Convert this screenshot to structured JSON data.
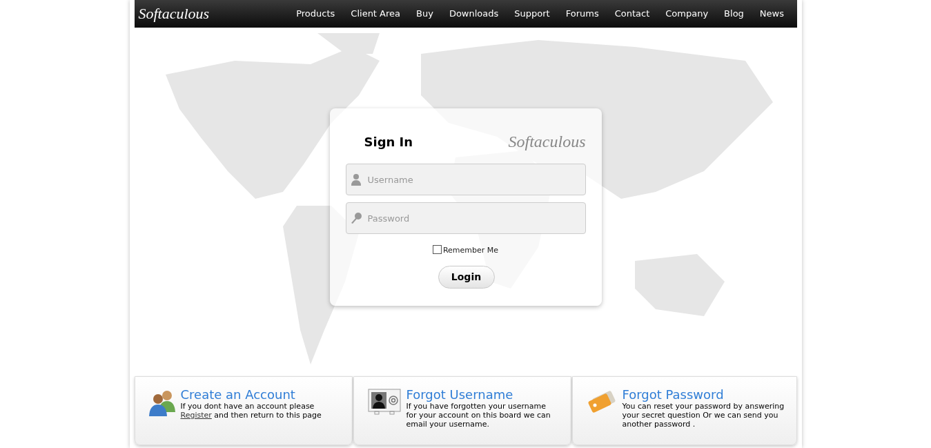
{
  "header": {
    "logo": "Softaculous",
    "nav": [
      "Products",
      "Client Area",
      "Buy",
      "Downloads",
      "Support",
      "Forums",
      "Contact",
      "Company",
      "Blog",
      "News"
    ]
  },
  "login": {
    "title": "Sign In",
    "logo": "Softaculous",
    "username": {
      "placeholder": "Username"
    },
    "password": {
      "placeholder": "Password"
    },
    "remember": {
      "label": "Remember Me",
      "checked": false
    },
    "button": "Login"
  },
  "cards": [
    {
      "kind": "account",
      "title": "Create an Account",
      "text_before": "If you dont have an account please",
      "link": "Register",
      "text_after": "and then return to this page"
    },
    {
      "kind": "username",
      "title": "Forgot Username",
      "text_before": "If you have forgotten your username for your account on this board we can email your username."
    },
    {
      "kind": "password",
      "title": "Forgot Password",
      "text_before": "You can reset your password by answering your secret question Or we can send you another password ."
    }
  ]
}
